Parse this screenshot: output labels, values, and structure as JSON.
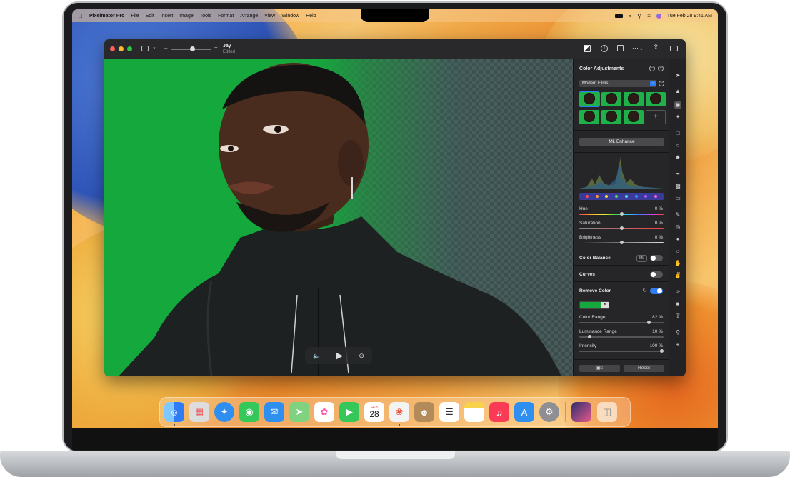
{
  "menubar": {
    "apple_icon": "apple-icon",
    "app_name": "Pixelmator Pro",
    "items": [
      "File",
      "Edit",
      "Insert",
      "Image",
      "Tools",
      "Format",
      "Arrange",
      "View",
      "Window",
      "Help"
    ],
    "clock": "Tue Feb 28  9:41 AM"
  },
  "window": {
    "doc_title": "Jay",
    "doc_subtitle": "Edited",
    "zoom_minus": "–",
    "zoom_plus": "+"
  },
  "panel": {
    "title": "Color Adjustments",
    "preset_select": "Modern Films",
    "add_preset": "+",
    "ml_enhance": "ML Enhance",
    "sliders": [
      {
        "label": "Hue",
        "value": "0 %"
      },
      {
        "label": "Saturation",
        "value": "0 %"
      },
      {
        "label": "Brightness",
        "value": "0 %"
      }
    ],
    "color_balance": "Color Balance",
    "ml_badge": "ML",
    "curves": "Curves",
    "remove_color": "Remove Color",
    "remove_sliders": [
      {
        "label": "Color Range",
        "value": "82 %"
      },
      {
        "label": "Luminance Range",
        "value": "10 %"
      },
      {
        "label": "Intensity",
        "value": "100 %"
      }
    ],
    "reset": "Reset"
  },
  "dock": {
    "calendar_month": "FEB",
    "calendar_day": "28"
  },
  "colors": {
    "accent": "#2f7cf6",
    "key_green": "#15a83d"
  }
}
